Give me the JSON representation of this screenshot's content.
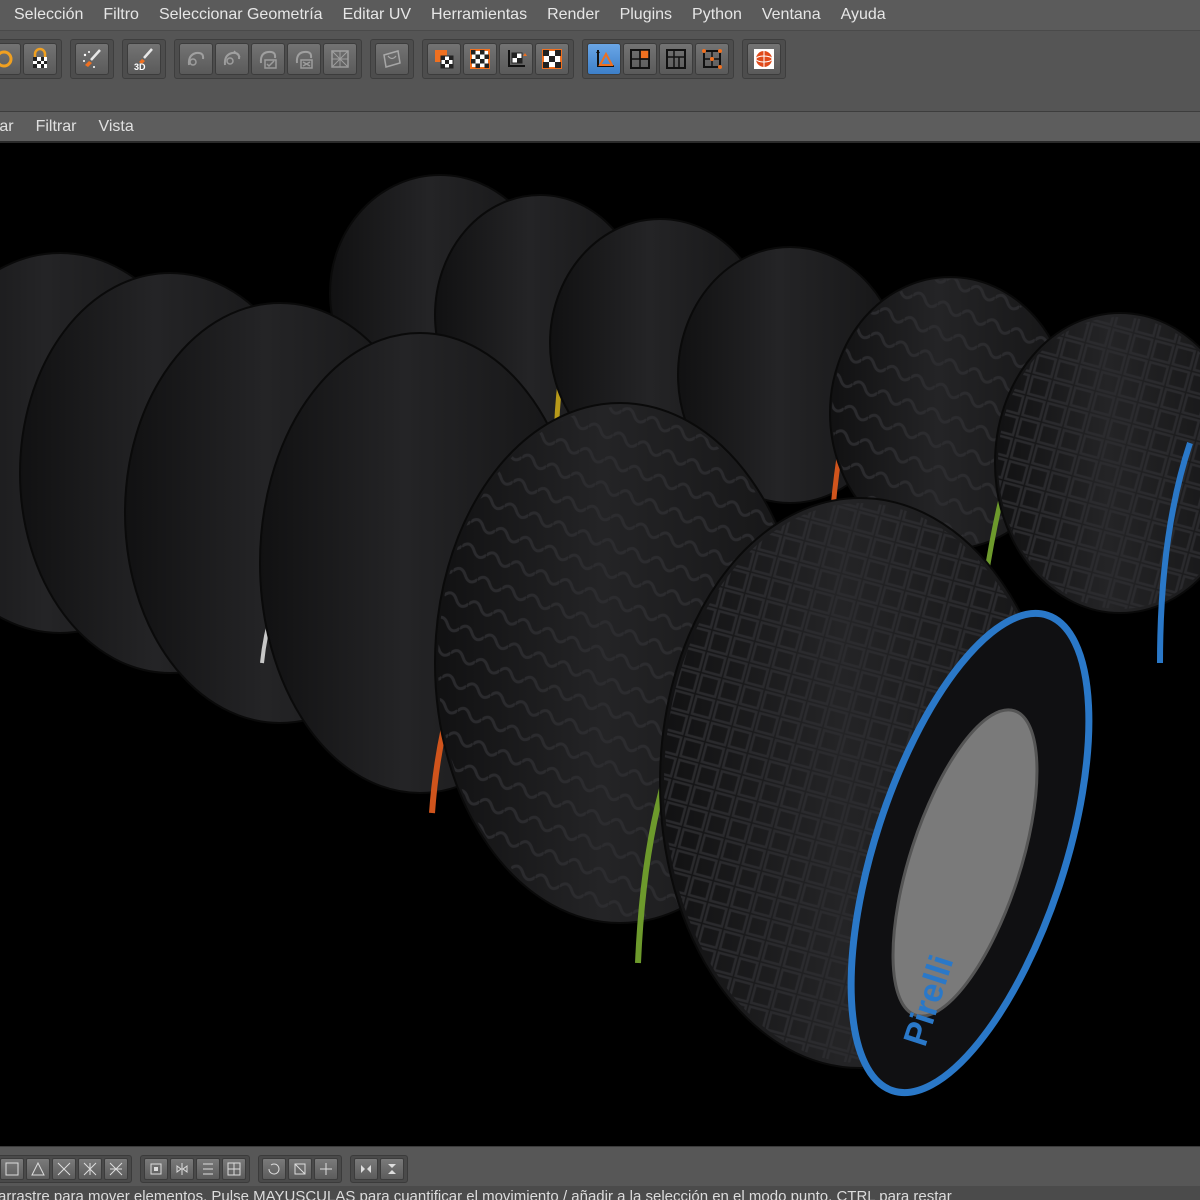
{
  "menubar": {
    "items": [
      "Selección",
      "Filtro",
      "Seleccionar Geometría",
      "Editar UV",
      "Herramientas",
      "Render",
      "Plugins",
      "Python",
      "Ventana",
      "Ayuda"
    ]
  },
  "toolbar": {
    "tools": [
      {
        "name": "live-selection-icon",
        "group": 1
      },
      {
        "name": "lock-checker-icon",
        "group": 1
      },
      {
        "name": "paint-brush-icon",
        "group": 2
      },
      {
        "name": "paint-3d-icon",
        "label": "3D",
        "group": 3
      },
      {
        "name": "uv-tool-1-icon",
        "group": 4
      },
      {
        "name": "uv-tool-2-icon",
        "group": 4
      },
      {
        "name": "uv-tool-3-icon",
        "group": 4
      },
      {
        "name": "uv-tool-4-icon",
        "group": 4
      },
      {
        "name": "uv-tool-5-icon",
        "group": 4
      },
      {
        "name": "uv-edit-icon",
        "group": 5
      },
      {
        "name": "texture-checker-1-icon",
        "group": 6
      },
      {
        "name": "texture-checker-2-icon",
        "group": 6
      },
      {
        "name": "texture-axis-icon",
        "group": 6
      },
      {
        "name": "texture-checker-3-icon",
        "group": 6
      },
      {
        "name": "points-mode-icon",
        "group": 7,
        "active": true
      },
      {
        "name": "edges-mode-icon",
        "group": 7
      },
      {
        "name": "polygons-mode-icon",
        "group": 7
      },
      {
        "name": "uv-points-mode-icon",
        "group": 7
      },
      {
        "name": "render-sphere-icon",
        "group": 8
      }
    ]
  },
  "submenu": {
    "items": [
      "rar",
      "Filtrar",
      "Vista"
    ]
  },
  "viewport": {
    "scene": "3D viewport with rendered tires",
    "colors": {
      "background": "#000000",
      "tire": "#1b1b1c",
      "stripe_red": "#b8321c",
      "stripe_yellow": "#b89a1a",
      "stripe_white": "#c8c8c8",
      "stripe_orange": "#d0541c",
      "stripe_green": "#6d9a2c",
      "stripe_blue": "#2a78c8"
    },
    "brand_text": "Pirelli"
  },
  "status": {
    "text": "arrastre para mover elementos. Pulse MAYUSCULAS para cuantificar el movimiento / añadir a la selección en el modo punto, CTRL para restar"
  }
}
